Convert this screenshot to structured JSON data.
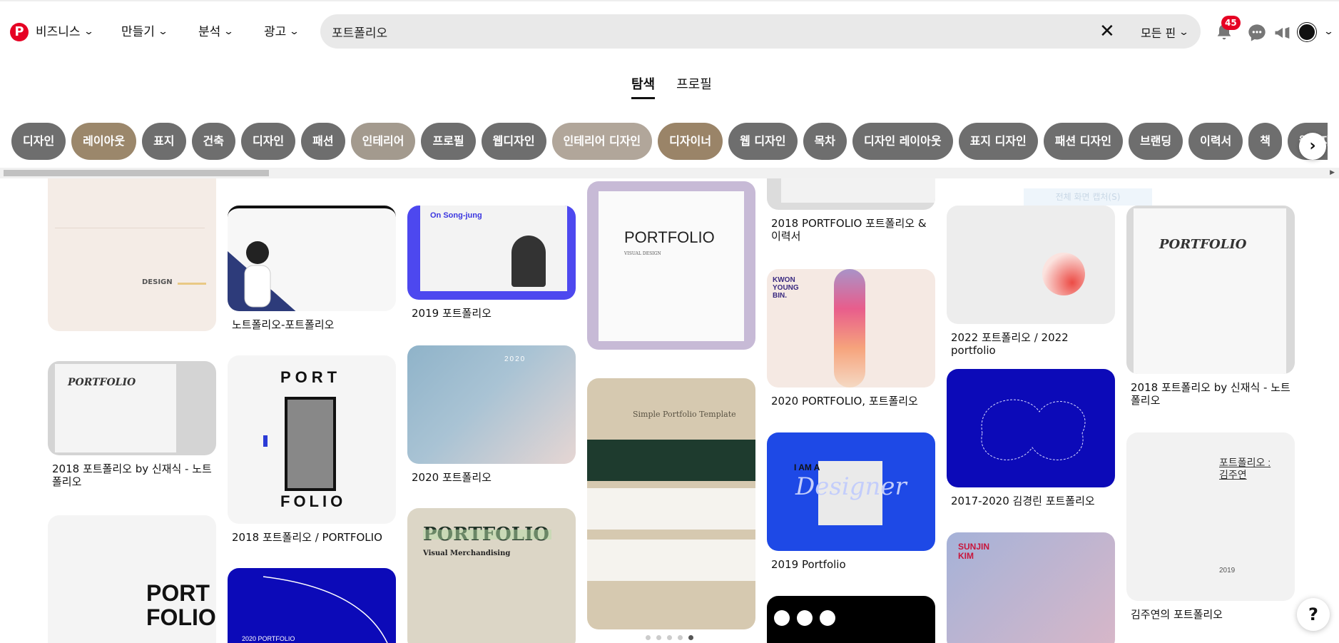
{
  "header": {
    "nav": [
      "비즈니스",
      "만들기",
      "분석",
      "광고"
    ],
    "search_value": "포트폴리오",
    "filter_label": "모든 핀",
    "notification_count": "45"
  },
  "tabs": [
    "탐색",
    "프로필"
  ],
  "chips": [
    {
      "label": "디자인",
      "color": "#6e6e6e"
    },
    {
      "label": "레이아웃",
      "color": "#9b876b"
    },
    {
      "label": "표지",
      "color": "#6e6e6e"
    },
    {
      "label": "건축",
      "color": "#6e6e6e"
    },
    {
      "label": "디자인",
      "color": "#6e6e6e"
    },
    {
      "label": "패션",
      "color": "#6e6e6e"
    },
    {
      "label": "인테리어",
      "color": "#a39a8e"
    },
    {
      "label": "프로필",
      "color": "#6e6e6e"
    },
    {
      "label": "웹디자인",
      "color": "#6e6e6e"
    },
    {
      "label": "인테리어 디자인",
      "color": "#b1a69a"
    },
    {
      "label": "디자이너",
      "color": "#9a8468"
    },
    {
      "label": "웹 디자인",
      "color": "#6e6e6e"
    },
    {
      "label": "목차",
      "color": "#6e6e6e"
    },
    {
      "label": "디자인 레이아웃",
      "color": "#6e6e6e"
    },
    {
      "label": "표지 디자인",
      "color": "#6e6e6e"
    },
    {
      "label": "패션 디자인",
      "color": "#6e6e6e"
    },
    {
      "label": "브랜딩",
      "color": "#6e6e6e"
    },
    {
      "label": "이력서",
      "color": "#6e6e6e"
    },
    {
      "label": "책",
      "color": "#6e6e6e"
    },
    {
      "label": "웹디자이너",
      "color": "#6e6e6e"
    }
  ],
  "pins": {
    "c1p2": "2018 포트폴리오 by 신재식 - 노트폴리오",
    "c2p1": "노트폴리오-포트폴리오",
    "c2p2": "2018 포트폴리오 / PORTFOLIO",
    "c3p1": "2019 포트폴리오",
    "c3p2": "2020 포트폴리오",
    "c5p0": "2018 PORTFOLIO 포트폴리오 & 이력서",
    "c5p1": "2020 PORTFOLIO, 포트폴리오",
    "c5p2": "2019 Portfolio",
    "c6p1": "2022 포트폴리오 / 2022 portfolio",
    "c6p2": "2017-2020 김경린 포트폴리오",
    "c7p1": "2018 포트폴리오 by 신재식 - 노트폴리오",
    "c7p2": "김주연의 포트폴리오"
  },
  "art": {
    "design": "DESIGN",
    "portfolio_caps": "PORTFOLIO",
    "portfolio_italic": "PORTFOLIO",
    "port": "PORT",
    "folio": "FOLIO",
    "on_song_jung": "On Song-jung",
    "simple_template": "Simple Portfolio Template",
    "visual_merch": "Visual Merchandising",
    "year_2020": "2020",
    "kwon": "KWON YOUNG BIN.",
    "i_am_a": "I AM A",
    "designer": "Designer",
    "sunjin": "SUNJIN KIM",
    "kim_ju_title": "포트폴리오 :김주연",
    "year_2019": "2019",
    "portfolio_2020": "2020 PORTFOLIO",
    "visual_design": "VISUAL DESIGN",
    "tip": "전체 화면 캡처(S)"
  }
}
